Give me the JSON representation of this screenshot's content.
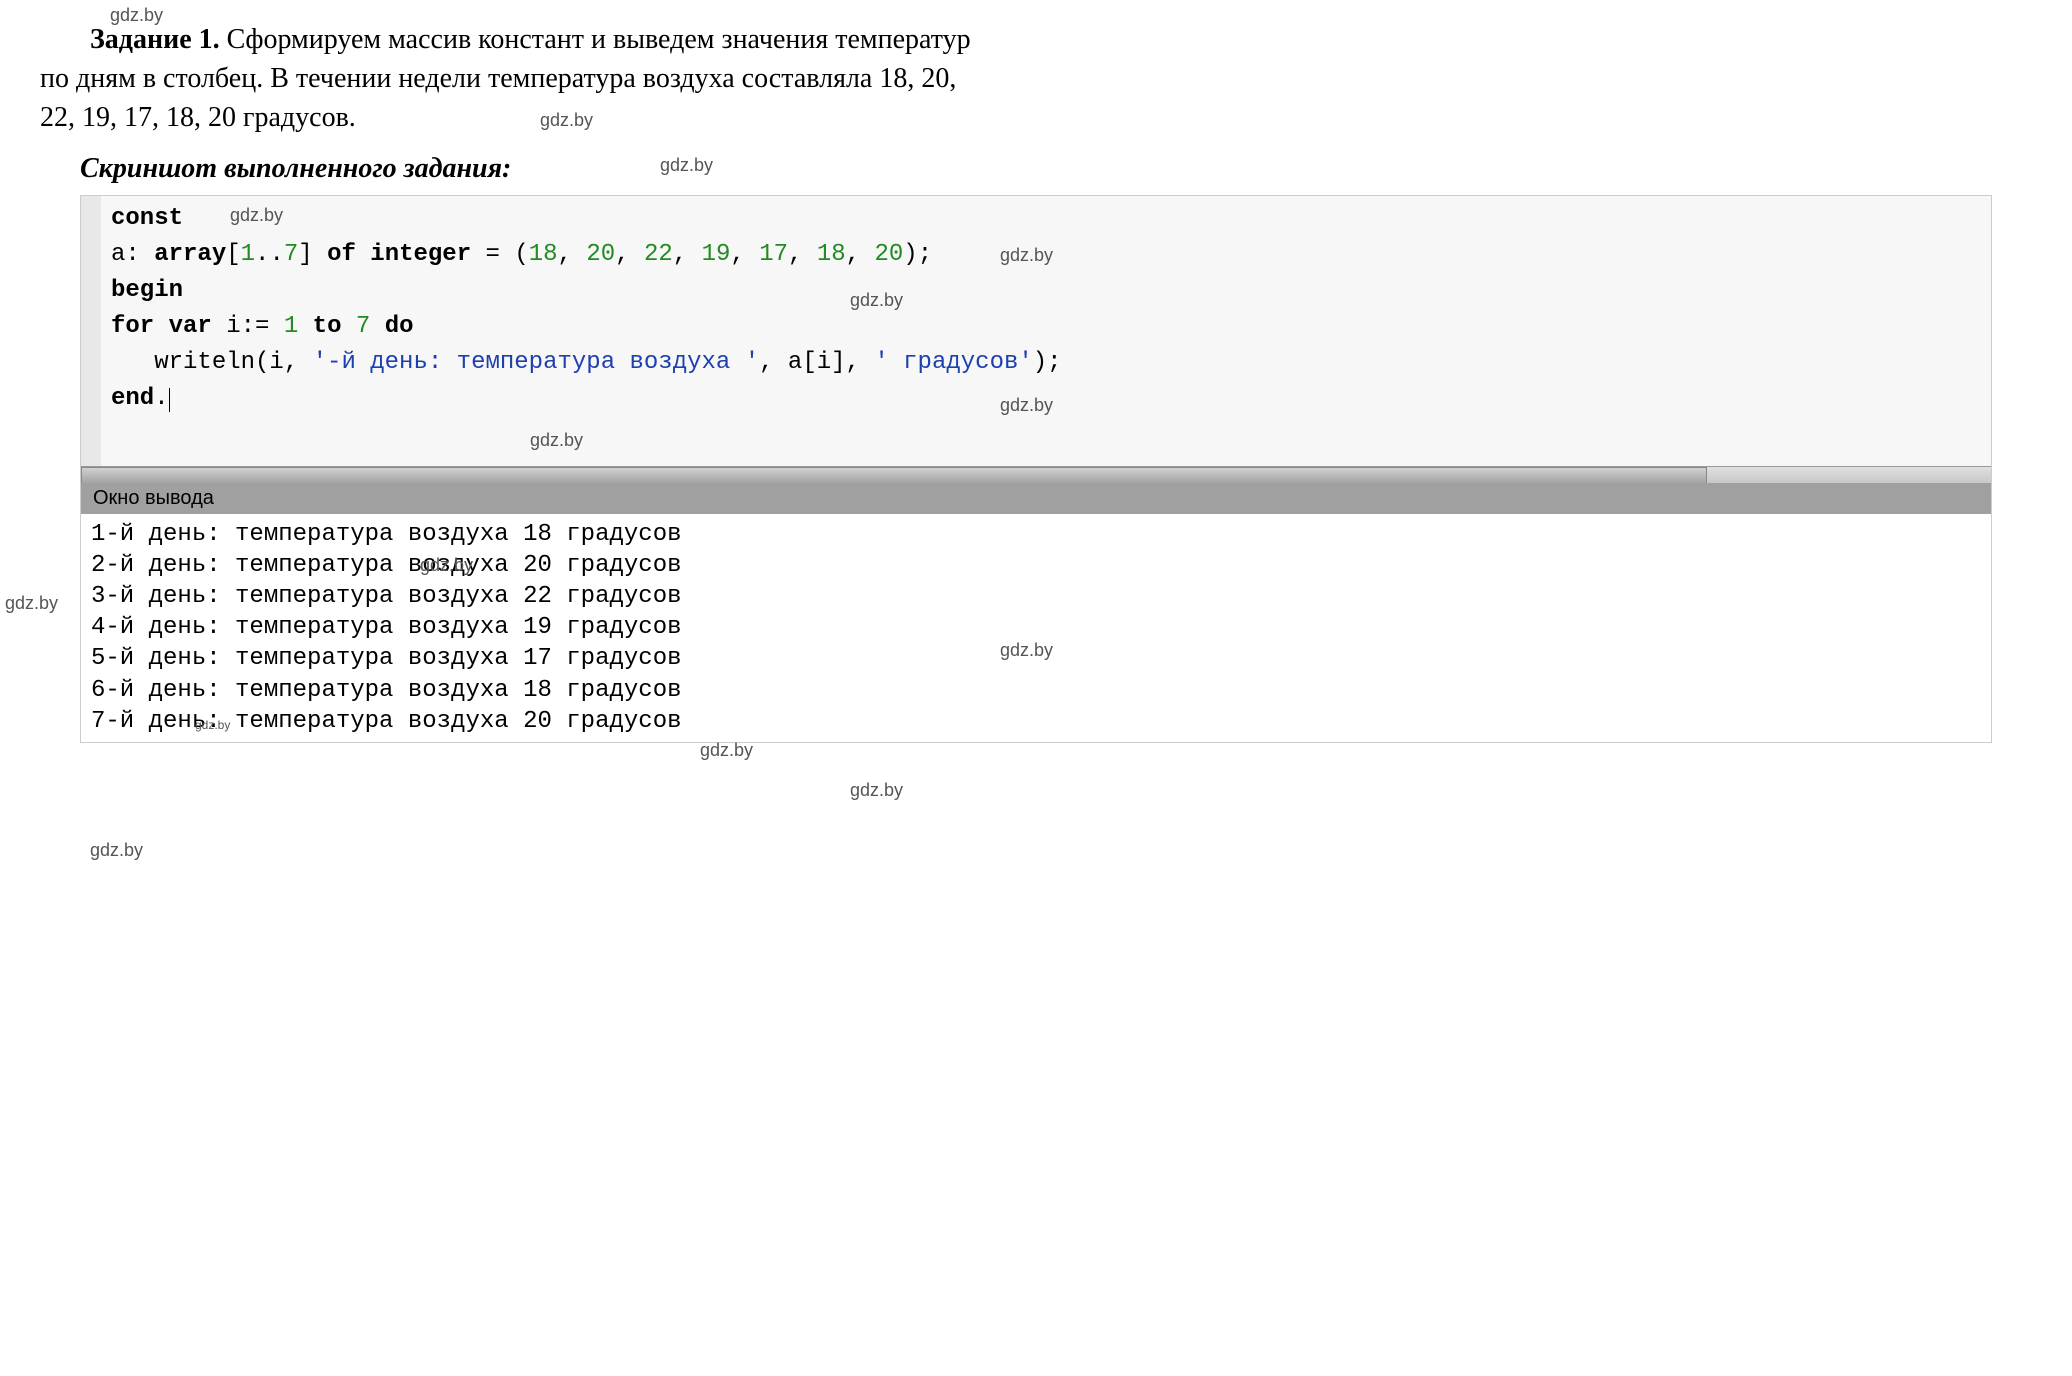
{
  "problem": {
    "title": "Задание 1.",
    "text_line1": "Сформируем массив констант и выведем значения температур",
    "text_line2": "по дням в столбец. В течении недели температура воздуха составляла 18, 20,",
    "text_line3": "22, 19, 17, 18, 20 градусов."
  },
  "screenshot_label": "Скриншот выполненного задания:",
  "code": {
    "line1_const": "const",
    "line2_prefix": "a: ",
    "line2_array": "array",
    "line2_bracket_open": "[",
    "line2_one": "1",
    "line2_dots": "..",
    "line2_seven": "7",
    "line2_bracket_close": "] ",
    "line2_of": "of",
    "line2_space": " ",
    "line2_integer": "integer",
    "line2_equals": " = (",
    "line2_v1": "18",
    "line2_c": ", ",
    "line2_v2": "20",
    "line2_v3": "22",
    "line2_v4": "19",
    "line2_v5": "17",
    "line2_v6": "18",
    "line2_v7": "20",
    "line2_end": ");",
    "line3_begin": "begin",
    "line4_for": "for",
    "line4_var": "var",
    "line4_i": " i:= ",
    "line4_1": "1",
    "line4_to": "to",
    "line4_7": "7",
    "line4_do": "do",
    "line5_indent": "   writeln(i, ",
    "line5_str1": "'-й день: температура воздуха '",
    "line5_mid": ", a[i], ",
    "line5_str2": "' градусов'",
    "line5_end": ");",
    "line6_end": "end",
    "line6_dot": "."
  },
  "output_header": "Окно вывода",
  "output": {
    "line1": "1-й день: температура воздуха 18 градусов",
    "line2": "2-й день: температура воздуха 20 градусов",
    "line3": "3-й день: температура воздуха 22 градусов",
    "line4": "4-й день: температура воздуха 19 градусов",
    "line5": "5-й день: температура воздуха 17 градусов",
    "line6": "6-й день: температура воздуха 18 градусов",
    "line7": "7-й день: температура воздуха 20 градусов"
  },
  "watermarks": {
    "w1": "gdz.by",
    "w2": "gdz.by",
    "w3": "gdz.by",
    "w4": "gdz.by",
    "w5": "gdz.by",
    "w6": "gdz.by",
    "w7": "gdz.by",
    "w8": "gdz.by",
    "w9": "gdz.by",
    "w10": "gdz.by",
    "w11": "gdz.by",
    "w12": "gdz.by",
    "w13": "gdz.by"
  }
}
